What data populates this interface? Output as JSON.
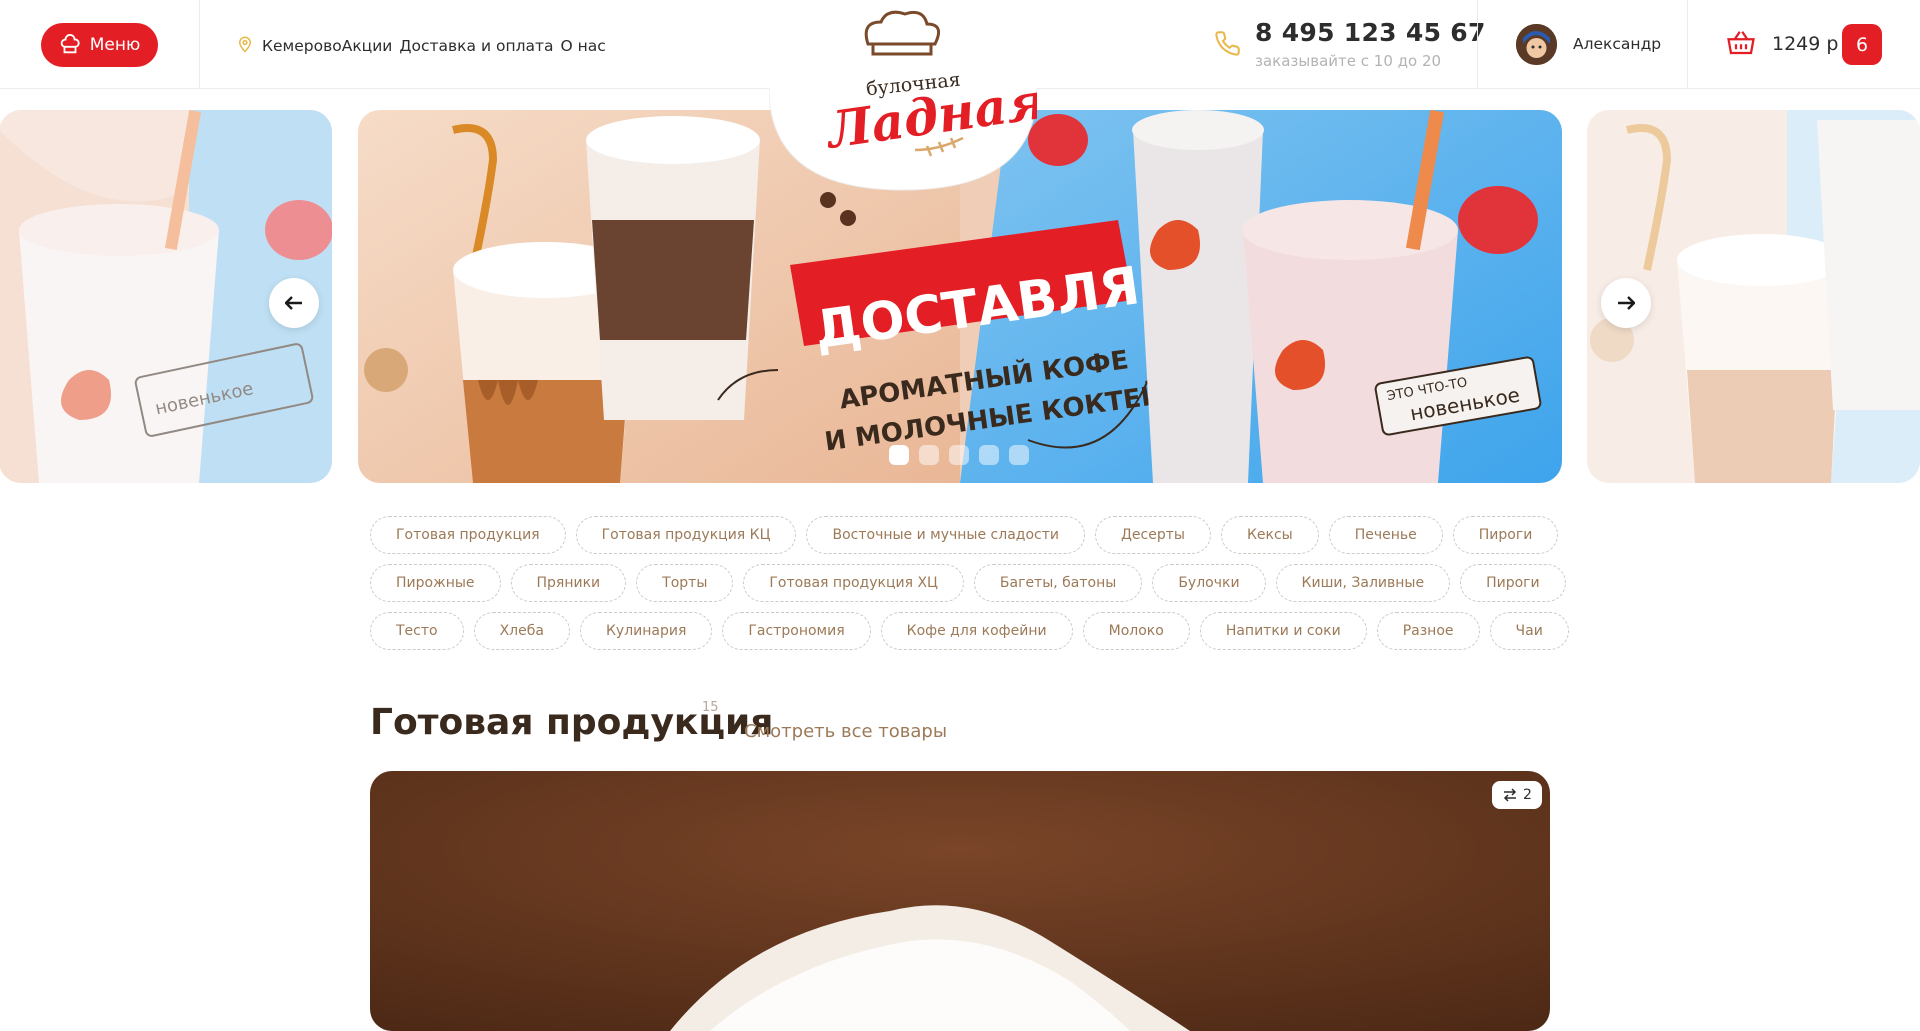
{
  "header": {
    "menu_label": "Меню",
    "nav": {
      "city": "Кемерово",
      "items": [
        "Акции",
        "Доставка и оплата",
        "О нас"
      ]
    },
    "phone": "8 495 123 45 67",
    "phone_note": "заказывайте с 10 до 20",
    "user_name": "Александр",
    "cart_sum": "1249 р",
    "cart_count": "6"
  },
  "logo": {
    "line1": "булочная",
    "line2": "Ладная"
  },
  "banner": {
    "headline": "ДОСТАВЛЯЕМ!",
    "line1": "АРОМАТНЫЙ КОФЕ",
    "line2": "И МОЛОЧНЫЕ КОКТЕЙЛИ",
    "tag_top": "ЭТО ЧТО-ТО",
    "tag_bottom": "новенькое",
    "slide_count": 5,
    "active_slide": 1
  },
  "categories": [
    [
      "Готовая продукция",
      "Готовая продукция КЦ",
      "Восточные и мучные сладости",
      "Десерты",
      "Кексы",
      "Печенье",
      "Пироги"
    ],
    [
      "Пирожные",
      "Пряники",
      "Торты",
      "Готовая продукция ХЦ",
      "Багеты, батоны",
      "Булочки",
      "Киши, Заливные",
      "Пироги"
    ],
    [
      "Тесто",
      "Хлеба",
      "Кулинария",
      "Гастрономия",
      "Кофе для кофейни",
      "Молоко",
      "Напитки и соки",
      "Разное",
      "Чаи"
    ]
  ],
  "section": {
    "title": "Готовая продукция",
    "count": "15",
    "link": "Смотреть все товары"
  },
  "product": {
    "compare_count": "2"
  },
  "colors": {
    "accent": "#e31e24",
    "brown": "#9c7a58",
    "text": "#3a2a1e"
  }
}
